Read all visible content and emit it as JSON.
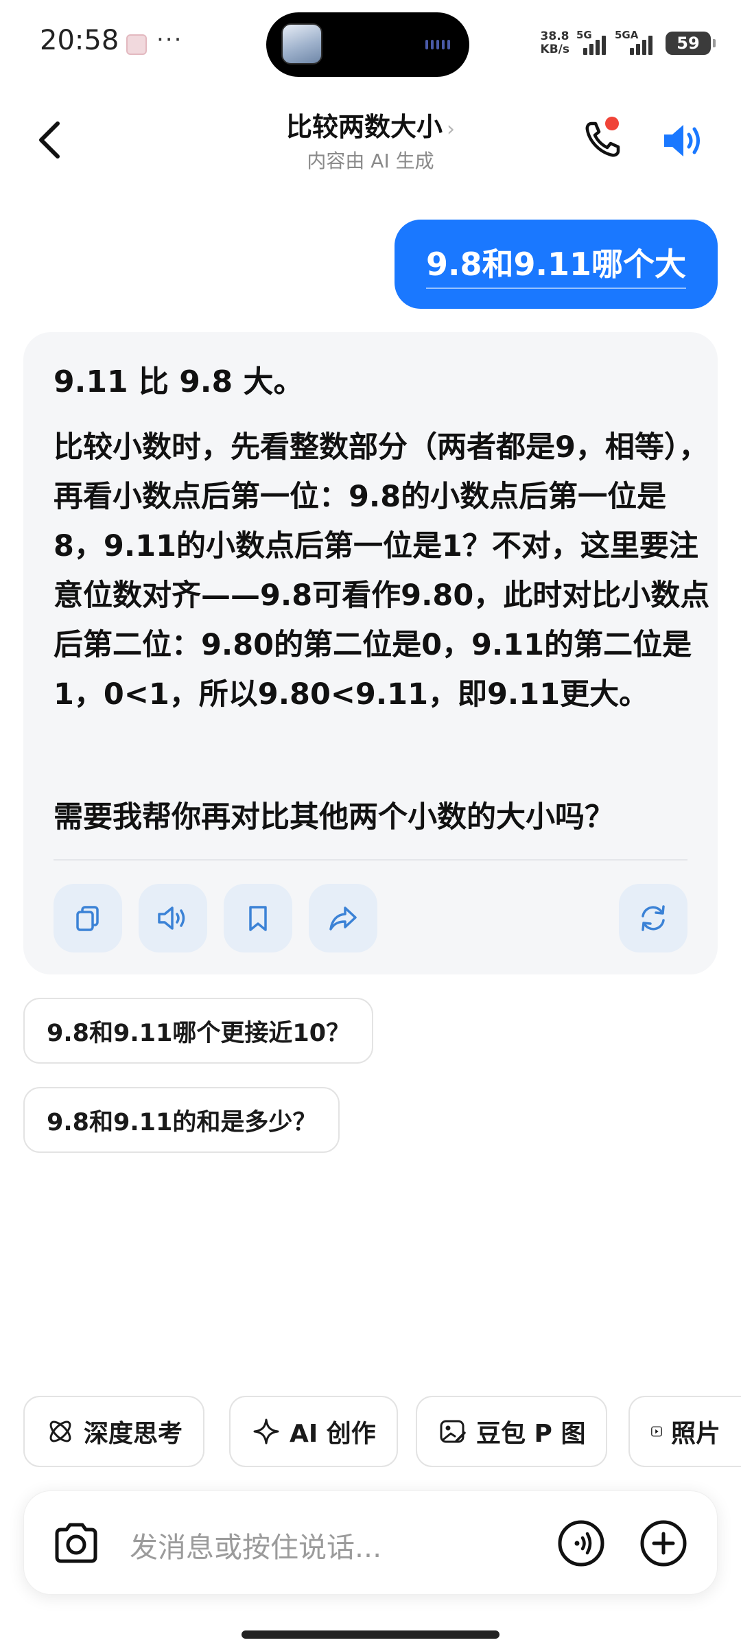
{
  "status_bar": {
    "time": "20:58",
    "dots": "···",
    "net_speed_value": "38.8",
    "net_speed_unit": "KB/s",
    "signal1_label": "5G",
    "signal2_label": "5GA",
    "battery": "59"
  },
  "header": {
    "title": "比较两数大小",
    "title_chevron": "›",
    "subtitle": "内容由 AI 生成"
  },
  "conversation": {
    "user_message": "9.8和9.11哪个大",
    "ai_headline": "9.11 比 9.8 大。",
    "ai_paragraph": "比较小数时，先看整数部分（两者都是9，相等），再看小数点后第一位：9.8的小数点后第一位是8，9.11的小数点后第一位是1？不对，这里要注意位数对齐——9.8可看作9.80，此时对比小数点后第二位：9.80的第二位是0，9.11的第二位是1，0<1，所以9.80<9.11，即9.11更大。",
    "ai_question": "需要我帮你再对比其他两个小数的大小吗？"
  },
  "actions": {
    "icons": [
      "copy-icon",
      "read-aloud-icon",
      "bookmark-icon",
      "share-icon",
      "regenerate-icon"
    ]
  },
  "suggestions": [
    {
      "label": "9.8和9.11哪个更接近10？"
    },
    {
      "label": "9.8和9.11的和是多少？"
    }
  ],
  "tools": [
    {
      "label": "深度思考",
      "icon": "atom-icon"
    },
    {
      "label": "AI 创作",
      "icon": "sparkle-icon"
    },
    {
      "label": "豆包 P 图",
      "icon": "image-edit-icon"
    },
    {
      "label": "照片",
      "icon": "play-icon"
    }
  ],
  "composer": {
    "placeholder": "发消息或按住说话..."
  },
  "colors": {
    "accent": "#1a78ff",
    "card_bg": "#f5f6f8",
    "action_bg": "#e6eef8",
    "icon_blue": "#3b82d6",
    "notify_red": "#f04438"
  }
}
